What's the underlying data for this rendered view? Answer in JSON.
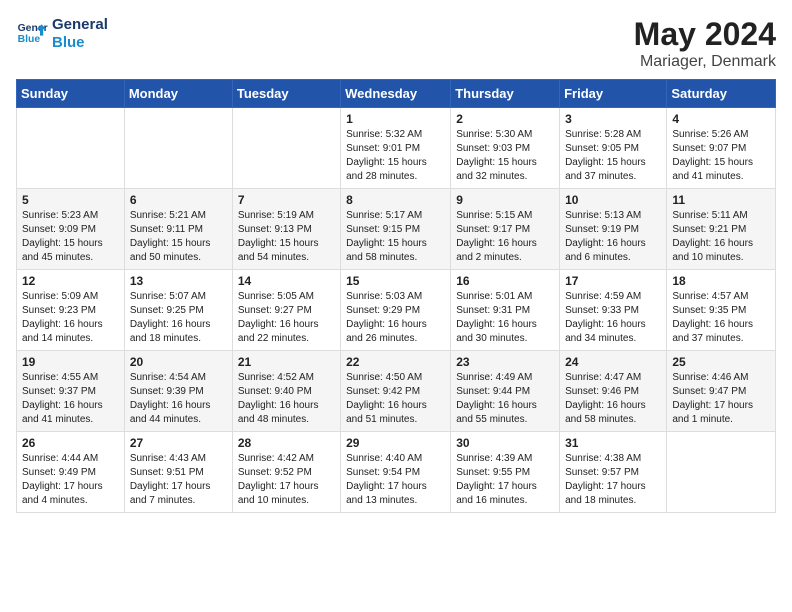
{
  "header": {
    "logo_line1": "General",
    "logo_line2": "Blue",
    "month": "May 2024",
    "location": "Mariager, Denmark"
  },
  "days_of_week": [
    "Sunday",
    "Monday",
    "Tuesday",
    "Wednesday",
    "Thursday",
    "Friday",
    "Saturday"
  ],
  "weeks": [
    {
      "days": [
        {
          "number": "",
          "info": ""
        },
        {
          "number": "",
          "info": ""
        },
        {
          "number": "",
          "info": ""
        },
        {
          "number": "1",
          "info": "Sunrise: 5:32 AM\nSunset: 9:01 PM\nDaylight: 15 hours\nand 28 minutes."
        },
        {
          "number": "2",
          "info": "Sunrise: 5:30 AM\nSunset: 9:03 PM\nDaylight: 15 hours\nand 32 minutes."
        },
        {
          "number": "3",
          "info": "Sunrise: 5:28 AM\nSunset: 9:05 PM\nDaylight: 15 hours\nand 37 minutes."
        },
        {
          "number": "4",
          "info": "Sunrise: 5:26 AM\nSunset: 9:07 PM\nDaylight: 15 hours\nand 41 minutes."
        }
      ]
    },
    {
      "days": [
        {
          "number": "5",
          "info": "Sunrise: 5:23 AM\nSunset: 9:09 PM\nDaylight: 15 hours\nand 45 minutes."
        },
        {
          "number": "6",
          "info": "Sunrise: 5:21 AM\nSunset: 9:11 PM\nDaylight: 15 hours\nand 50 minutes."
        },
        {
          "number": "7",
          "info": "Sunrise: 5:19 AM\nSunset: 9:13 PM\nDaylight: 15 hours\nand 54 minutes."
        },
        {
          "number": "8",
          "info": "Sunrise: 5:17 AM\nSunset: 9:15 PM\nDaylight: 15 hours\nand 58 minutes."
        },
        {
          "number": "9",
          "info": "Sunrise: 5:15 AM\nSunset: 9:17 PM\nDaylight: 16 hours\nand 2 minutes."
        },
        {
          "number": "10",
          "info": "Sunrise: 5:13 AM\nSunset: 9:19 PM\nDaylight: 16 hours\nand 6 minutes."
        },
        {
          "number": "11",
          "info": "Sunrise: 5:11 AM\nSunset: 9:21 PM\nDaylight: 16 hours\nand 10 minutes."
        }
      ]
    },
    {
      "days": [
        {
          "number": "12",
          "info": "Sunrise: 5:09 AM\nSunset: 9:23 PM\nDaylight: 16 hours\nand 14 minutes."
        },
        {
          "number": "13",
          "info": "Sunrise: 5:07 AM\nSunset: 9:25 PM\nDaylight: 16 hours\nand 18 minutes."
        },
        {
          "number": "14",
          "info": "Sunrise: 5:05 AM\nSunset: 9:27 PM\nDaylight: 16 hours\nand 22 minutes."
        },
        {
          "number": "15",
          "info": "Sunrise: 5:03 AM\nSunset: 9:29 PM\nDaylight: 16 hours\nand 26 minutes."
        },
        {
          "number": "16",
          "info": "Sunrise: 5:01 AM\nSunset: 9:31 PM\nDaylight: 16 hours\nand 30 minutes."
        },
        {
          "number": "17",
          "info": "Sunrise: 4:59 AM\nSunset: 9:33 PM\nDaylight: 16 hours\nand 34 minutes."
        },
        {
          "number": "18",
          "info": "Sunrise: 4:57 AM\nSunset: 9:35 PM\nDaylight: 16 hours\nand 37 minutes."
        }
      ]
    },
    {
      "days": [
        {
          "number": "19",
          "info": "Sunrise: 4:55 AM\nSunset: 9:37 PM\nDaylight: 16 hours\nand 41 minutes."
        },
        {
          "number": "20",
          "info": "Sunrise: 4:54 AM\nSunset: 9:39 PM\nDaylight: 16 hours\nand 44 minutes."
        },
        {
          "number": "21",
          "info": "Sunrise: 4:52 AM\nSunset: 9:40 PM\nDaylight: 16 hours\nand 48 minutes."
        },
        {
          "number": "22",
          "info": "Sunrise: 4:50 AM\nSunset: 9:42 PM\nDaylight: 16 hours\nand 51 minutes."
        },
        {
          "number": "23",
          "info": "Sunrise: 4:49 AM\nSunset: 9:44 PM\nDaylight: 16 hours\nand 55 minutes."
        },
        {
          "number": "24",
          "info": "Sunrise: 4:47 AM\nSunset: 9:46 PM\nDaylight: 16 hours\nand 58 minutes."
        },
        {
          "number": "25",
          "info": "Sunrise: 4:46 AM\nSunset: 9:47 PM\nDaylight: 17 hours\nand 1 minute."
        }
      ]
    },
    {
      "days": [
        {
          "number": "26",
          "info": "Sunrise: 4:44 AM\nSunset: 9:49 PM\nDaylight: 17 hours\nand 4 minutes."
        },
        {
          "number": "27",
          "info": "Sunrise: 4:43 AM\nSunset: 9:51 PM\nDaylight: 17 hours\nand 7 minutes."
        },
        {
          "number": "28",
          "info": "Sunrise: 4:42 AM\nSunset: 9:52 PM\nDaylight: 17 hours\nand 10 minutes."
        },
        {
          "number": "29",
          "info": "Sunrise: 4:40 AM\nSunset: 9:54 PM\nDaylight: 17 hours\nand 13 minutes."
        },
        {
          "number": "30",
          "info": "Sunrise: 4:39 AM\nSunset: 9:55 PM\nDaylight: 17 hours\nand 16 minutes."
        },
        {
          "number": "31",
          "info": "Sunrise: 4:38 AM\nSunset: 9:57 PM\nDaylight: 17 hours\nand 18 minutes."
        },
        {
          "number": "",
          "info": ""
        }
      ]
    }
  ]
}
